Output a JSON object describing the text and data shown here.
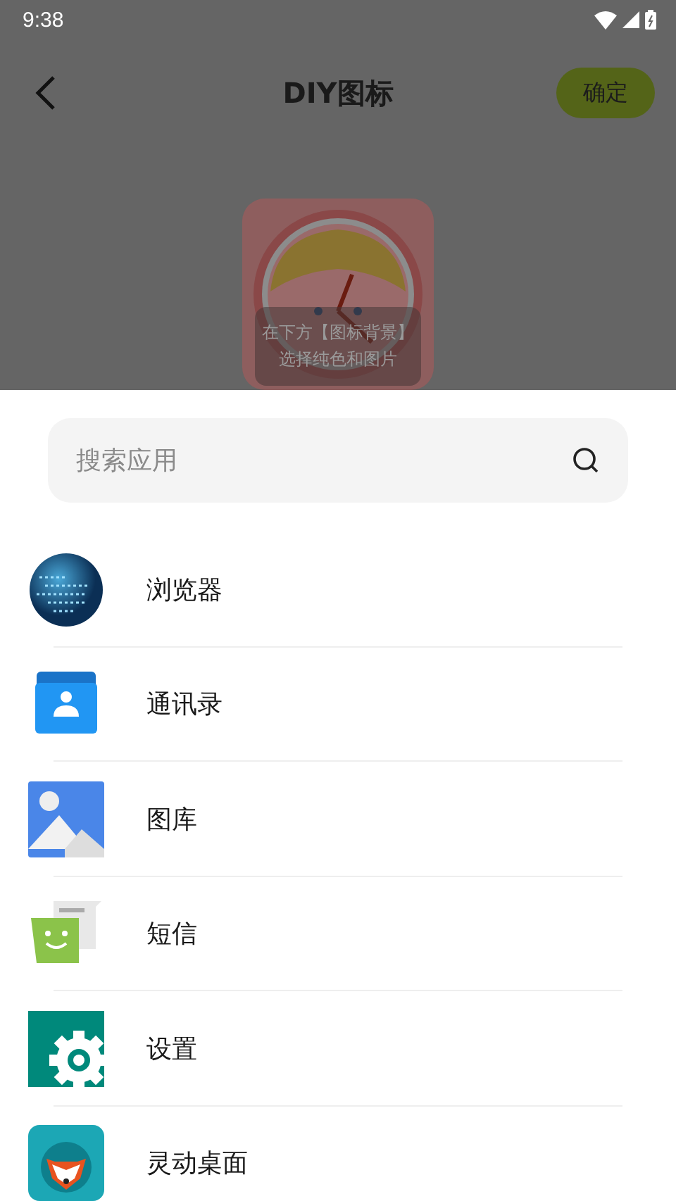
{
  "status_bar": {
    "time": "9:38"
  },
  "header": {
    "title": "DIY图标",
    "confirm": "确定"
  },
  "preview": {
    "hint_lines": [
      "在下方【图标背景】",
      "选择纯色和图片"
    ]
  },
  "search": {
    "placeholder": "搜索应用"
  },
  "apps": [
    {
      "name": "浏览器"
    },
    {
      "name": "通讯录"
    },
    {
      "name": "图库"
    },
    {
      "name": "短信"
    },
    {
      "name": "设置"
    },
    {
      "name": "灵动桌面"
    }
  ]
}
